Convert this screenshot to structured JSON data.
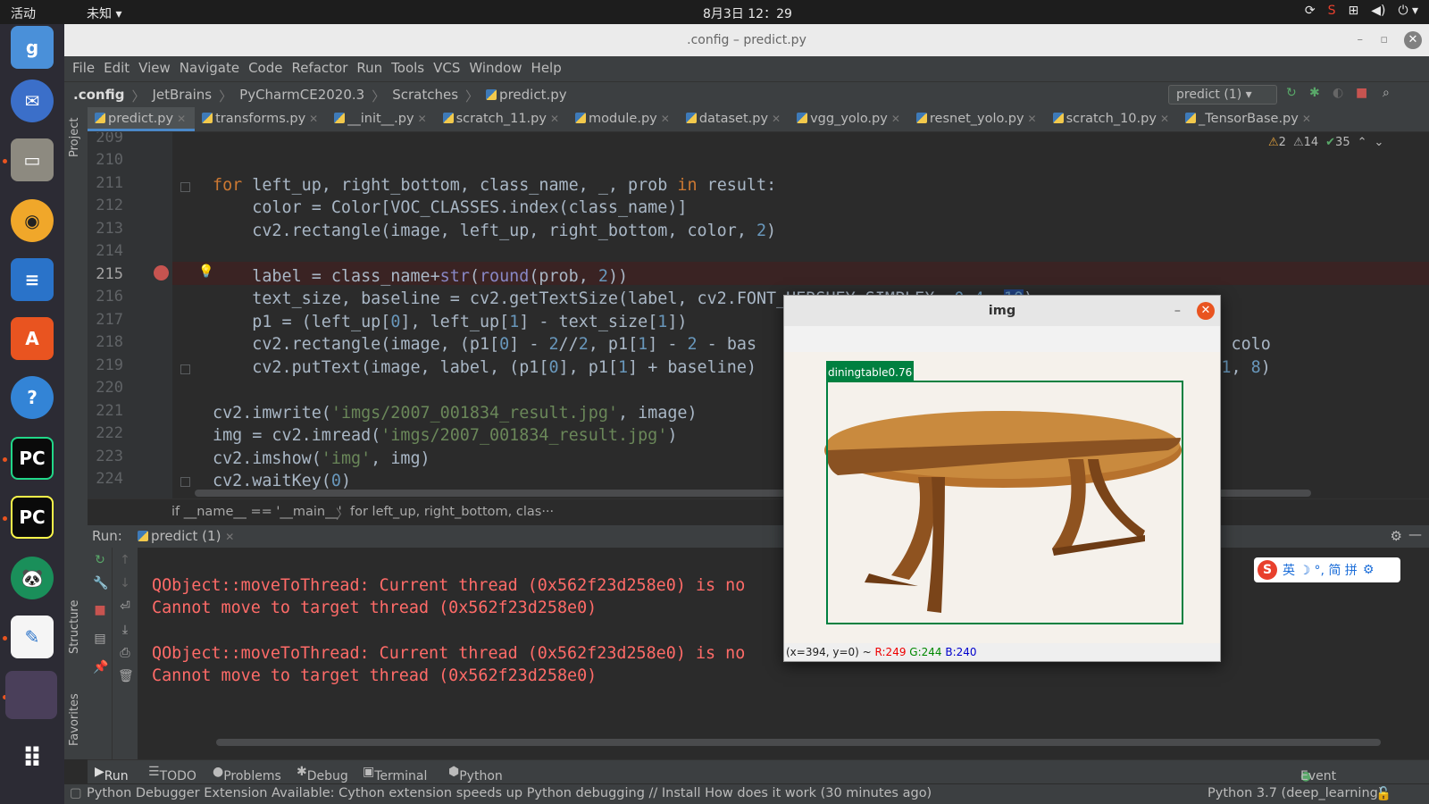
{
  "topbar": {
    "activities": "活动",
    "app_menu": "未知 ▾",
    "clock": "8月3日  12：29"
  },
  "window": {
    "title": ".config – predict.py"
  },
  "menu": [
    "File",
    "Edit",
    "View",
    "Navigate",
    "Code",
    "Refactor",
    "Run",
    "Tools",
    "VCS",
    "Window",
    "Help"
  ],
  "breadcrumb": [
    ".config",
    "JetBrains",
    "PyCharmCE2020.3",
    "Scratches",
    "predict.py"
  ],
  "run_config": "predict (1)",
  "tabs": [
    "predict.py",
    "transforms.py",
    "__init__.py",
    "scratch_11.py",
    "module.py",
    "dataset.py",
    "vgg_yolo.py",
    "resnet_yolo.py",
    "scratch_10.py",
    "_TensorBase.py"
  ],
  "inspections": {
    "warnings": "2",
    "weak": "14",
    "ok": "35"
  },
  "editor": {
    "line_numbers": [
      "209",
      "210",
      "211",
      "212",
      "213",
      "214",
      "215",
      "216",
      "217",
      "218",
      "219",
      "220",
      "221",
      "222",
      "223",
      "224"
    ],
    "current_line": "215"
  },
  "code_breadcrumb": [
    "if __name__ == '__main__'",
    "for left_up, right_bottom, clas···"
  ],
  "run_panel": {
    "label": "Run:",
    "config": "predict (1)",
    "console": [
      "QObject::moveToThread: Current thread (0x562f23d258e0) is no",
      "Cannot move to target thread (0x562f23d258e0)",
      "",
      "QObject::moveToThread: Current thread (0x562f23d258e0) is no",
      "Cannot move to target thread (0x562f23d258e0)"
    ]
  },
  "side_labels": {
    "project": "Project",
    "structure": "Structure",
    "favorites": "Favorites"
  },
  "bottom_tabs": [
    "Run",
    "TODO",
    "Problems",
    "Debug",
    "Terminal",
    "Python Console"
  ],
  "event_log": "Event Log",
  "status": {
    "message": "Python Debugger Extension Available: Cython extension speeds up Python debugging // Install   How does it work (30 minutes ago)",
    "interpreter": "Python 3.7 (deep_learning)"
  },
  "ime": {
    "chars": "英 ☽ °, 简 拼"
  },
  "cv_window": {
    "title": "img",
    "detection_label": "diningtable0.76",
    "status_prefix": "(x=394, y=0) ~",
    "r": "R:249",
    "g": "G:244",
    "b": "B:240"
  },
  "colors": {
    "keyword": "#cc7832",
    "number": "#6897bb",
    "string": "#6a8759",
    "error_text": "#ff6b68",
    "bbox": "#008040"
  }
}
